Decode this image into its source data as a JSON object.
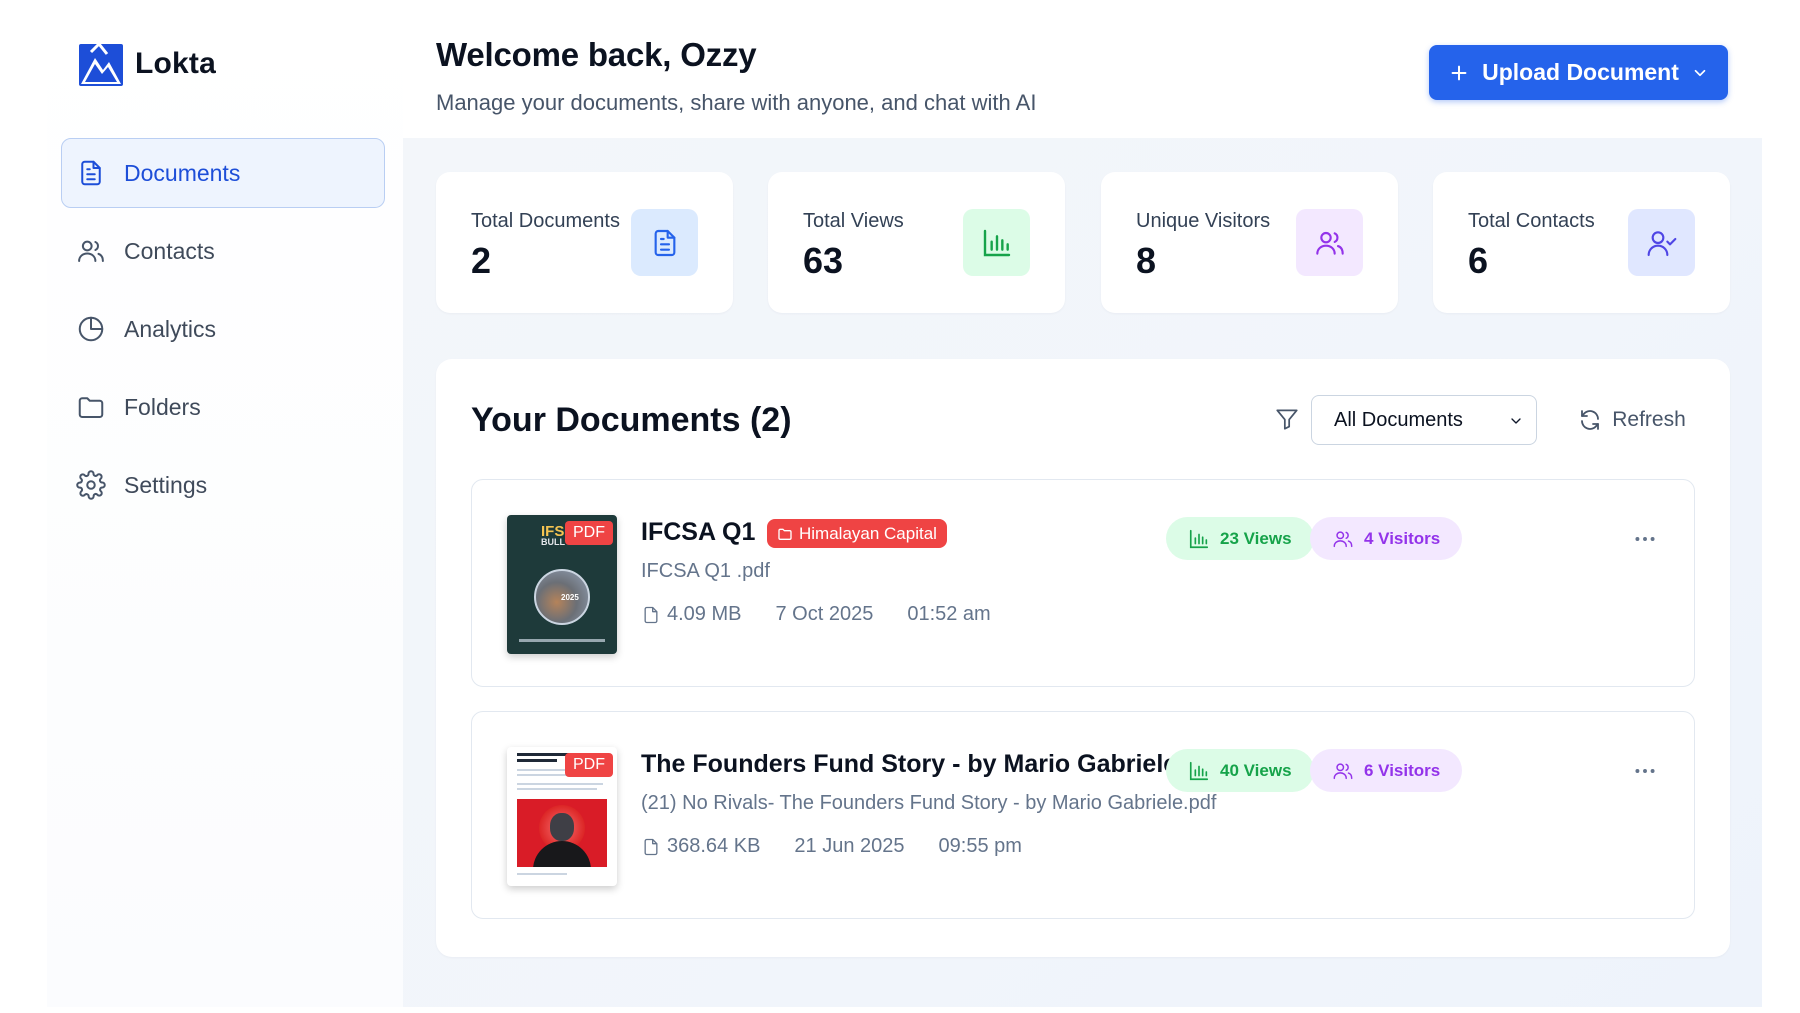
{
  "brand": {
    "name": "Lokta"
  },
  "header": {
    "welcome": "Welcome back, Ozzy",
    "subtitle": "Manage your documents, share with anyone, and chat with AI",
    "upload_label": "Upload Document"
  },
  "sidebar": {
    "items": [
      {
        "label": "Documents",
        "icon": "document-icon",
        "active": true
      },
      {
        "label": "Contacts",
        "icon": "users-icon",
        "active": false
      },
      {
        "label": "Analytics",
        "icon": "pie-chart-icon",
        "active": false
      },
      {
        "label": "Folders",
        "icon": "folder-icon",
        "active": false
      },
      {
        "label": "Settings",
        "icon": "gear-icon",
        "active": false
      }
    ]
  },
  "stats": [
    {
      "label": "Total Documents",
      "value": "2",
      "icon": "document-icon",
      "color": "#2563eb",
      "bg": "#dbeafe"
    },
    {
      "label": "Total Views",
      "value": "63",
      "icon": "bar-chart-icon",
      "color": "#16a34a",
      "bg": "#dcfce7"
    },
    {
      "label": "Unique Visitors",
      "value": "8",
      "icon": "users-icon",
      "color": "#9333ea",
      "bg": "#f3e8ff"
    },
    {
      "label": "Total Contacts",
      "value": "6",
      "icon": "user-check-icon",
      "color": "#4f46e5",
      "bg": "#e0e7ff"
    }
  ],
  "documents_panel": {
    "title": "Your Documents (2)",
    "filter_value": "All Documents",
    "refresh_label": "Refresh",
    "items": [
      {
        "title": "IFCSA Q1",
        "folder": "Himalayan Capital",
        "file_name": "IFCSA Q1 .pdf",
        "size": "4.09 MB",
        "date": "7 Oct 2025",
        "time": "01:52 am",
        "views": "23 Views",
        "visitors": "4 Visitors",
        "badge": "PDF",
        "thumb_text": "IFS",
        "thumb_sub": "BULL",
        "thumb_year": "2025"
      },
      {
        "title": "The Founders Fund Story - by Mario Gabriele",
        "file_name": "(21) No Rivals- The Founders Fund Story - by Mario Gabriele.pdf",
        "size": "368.64 KB",
        "date": "21 Jun 2025",
        "time": "09:55 pm",
        "views": "40 Views",
        "visitors": "6 Visitors",
        "badge": "PDF"
      }
    ]
  }
}
